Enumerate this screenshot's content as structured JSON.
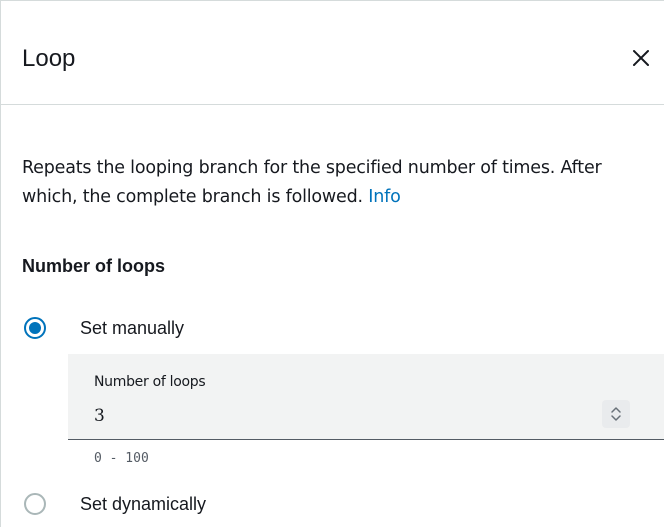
{
  "panel": {
    "title": "Loop",
    "close_icon": "close-icon"
  },
  "description": {
    "text": "Repeats the looping branch for the specified number of times. After which, the complete branch is followed. ",
    "info_link": "Info"
  },
  "number_of_loops": {
    "section_label": "Number of loops",
    "options": [
      {
        "label": "Set manually",
        "selected": true
      },
      {
        "label": "Set dynamically",
        "selected": false
      }
    ],
    "field": {
      "label": "Number of loops",
      "value": "3",
      "stepper_icon": "chevron-up-down-icon"
    },
    "range_hint": "0 - 100"
  },
  "colors": {
    "accent": "#0073bb",
    "border": "#d5dbdb",
    "input_bg": "#f2f3f3",
    "text": "#16191f",
    "muted": "#545b64"
  }
}
